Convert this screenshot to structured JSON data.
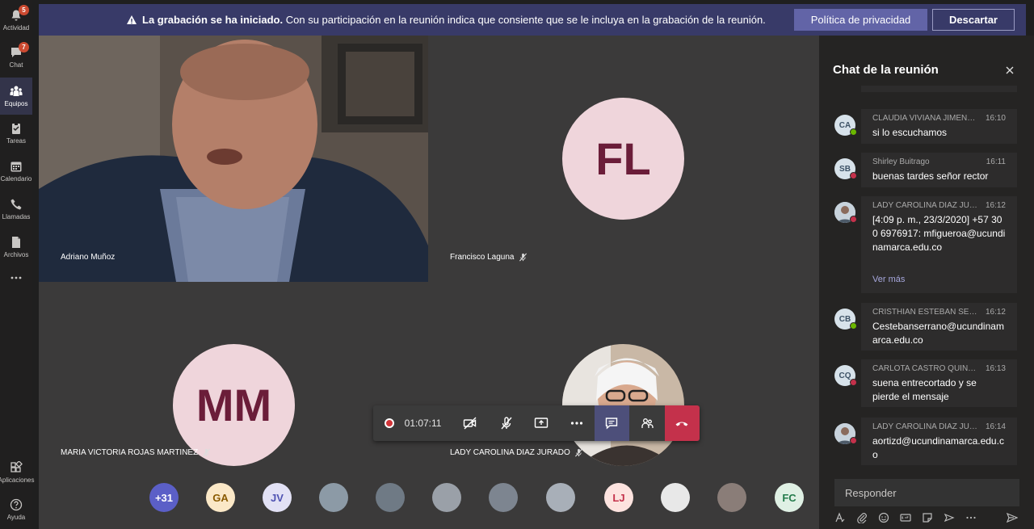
{
  "rail": {
    "items": [
      {
        "label": "Actividad",
        "badge": "5",
        "icon": "bell-icon"
      },
      {
        "label": "Chat",
        "badge": "7",
        "icon": "chat-icon"
      },
      {
        "label": "Equipos",
        "badge": "",
        "icon": "teams-icon"
      },
      {
        "label": "Tareas",
        "badge": "",
        "icon": "tasks-icon"
      },
      {
        "label": "Calendario",
        "badge": "",
        "icon": "calendar-icon"
      },
      {
        "label": "Llamadas",
        "badge": "",
        "icon": "phone-icon"
      },
      {
        "label": "Archivos",
        "badge": "",
        "icon": "file-icon"
      },
      {
        "label": "Aplicaciones",
        "badge": "",
        "icon": "apps-icon"
      },
      {
        "label": "Ayuda",
        "badge": "",
        "icon": "help-icon"
      }
    ]
  },
  "banner": {
    "title": "La grabación se ha iniciado.",
    "text": "Con su participación en la reunión indica que consiente que se le incluya en la grabación de la reunión.",
    "privacy_label": "Política de privacidad",
    "dismiss_label": "Descartar"
  },
  "tiles": {
    "t1": {
      "name": "Adriano Muñoz"
    },
    "t2": {
      "name": "Francisco Laguna",
      "initials": "FL"
    },
    "t3": {
      "name": "MARIA VICTORIA ROJAS MARTINEZ",
      "initials": "MM"
    },
    "t4": {
      "name": "LADY CAROLINA DIAZ JURADO"
    }
  },
  "controls": {
    "timer": "01:07:11"
  },
  "participants": [
    {
      "label": "+31",
      "bg": "#5b5fc7",
      "fg": "#ffffff"
    },
    {
      "label": "GA",
      "bg": "#fbe8c7",
      "fg": "#8a5a00"
    },
    {
      "label": "JV",
      "bg": "#e2e1f5",
      "fg": "#4f52b2"
    },
    {
      "label": "",
      "bg": "#8c9aa6",
      "fg": "#ffffff"
    },
    {
      "label": "",
      "bg": "#6f7a85",
      "fg": "#ffffff"
    },
    {
      "label": "",
      "bg": "#9aa0a8",
      "fg": "#ffffff"
    },
    {
      "label": "",
      "bg": "#7d8590",
      "fg": "#ffffff"
    },
    {
      "label": "",
      "bg": "#a8afb8",
      "fg": "#ffffff"
    },
    {
      "label": "LJ",
      "bg": "#fde3df",
      "fg": "#c4314b"
    },
    {
      "label": "",
      "bg": "#e8e8e8",
      "fg": "#333333"
    },
    {
      "label": "",
      "bg": "#8a7d78",
      "fg": "#ffffff"
    },
    {
      "label": "FC",
      "bg": "#dff0e4",
      "fg": "#237b4b"
    }
  ],
  "chat": {
    "title": "Chat de la reunión",
    "messages": [
      {
        "initials": "CA",
        "author": "CLAUDIA VIVIANA JIMENEZ...",
        "time": "16:10",
        "body": "si lo escuchamos",
        "status": "green",
        "photo": false
      },
      {
        "initials": "SB",
        "author": "Shirley Buitrago",
        "time": "16:11",
        "body": "buenas tardes señor rector",
        "status": "red",
        "photo": false
      },
      {
        "initials": "",
        "author": "LADY CAROLINA DIAZ JURA...",
        "time": "16:12",
        "body": "[4:09 p. m., 23/3/2020] +57 300 6976917: mfigueroa@ucundinamarca.edu.co",
        "status": "red",
        "photo": true,
        "more": "Ver más"
      },
      {
        "initials": "CB",
        "author": "CRISTHIAN ESTEBAN SERRA...",
        "time": "16:12",
        "body": "Cestebanserrano@ucundinamarca.edu.co",
        "status": "green",
        "photo": false
      },
      {
        "initials": "CQ",
        "author": "CARLOTA CASTRO QUINTA...",
        "time": "16:13",
        "body": "suena entrecortado y se pierde el mensaje",
        "status": "red",
        "photo": false
      },
      {
        "initials": "",
        "author": "LADY CAROLINA DIAZ JURA...",
        "time": "16:14",
        "body": "aortizd@ucundinamarca.edu.co",
        "status": "red",
        "photo": true
      }
    ],
    "compose_placeholder": "Responder"
  }
}
